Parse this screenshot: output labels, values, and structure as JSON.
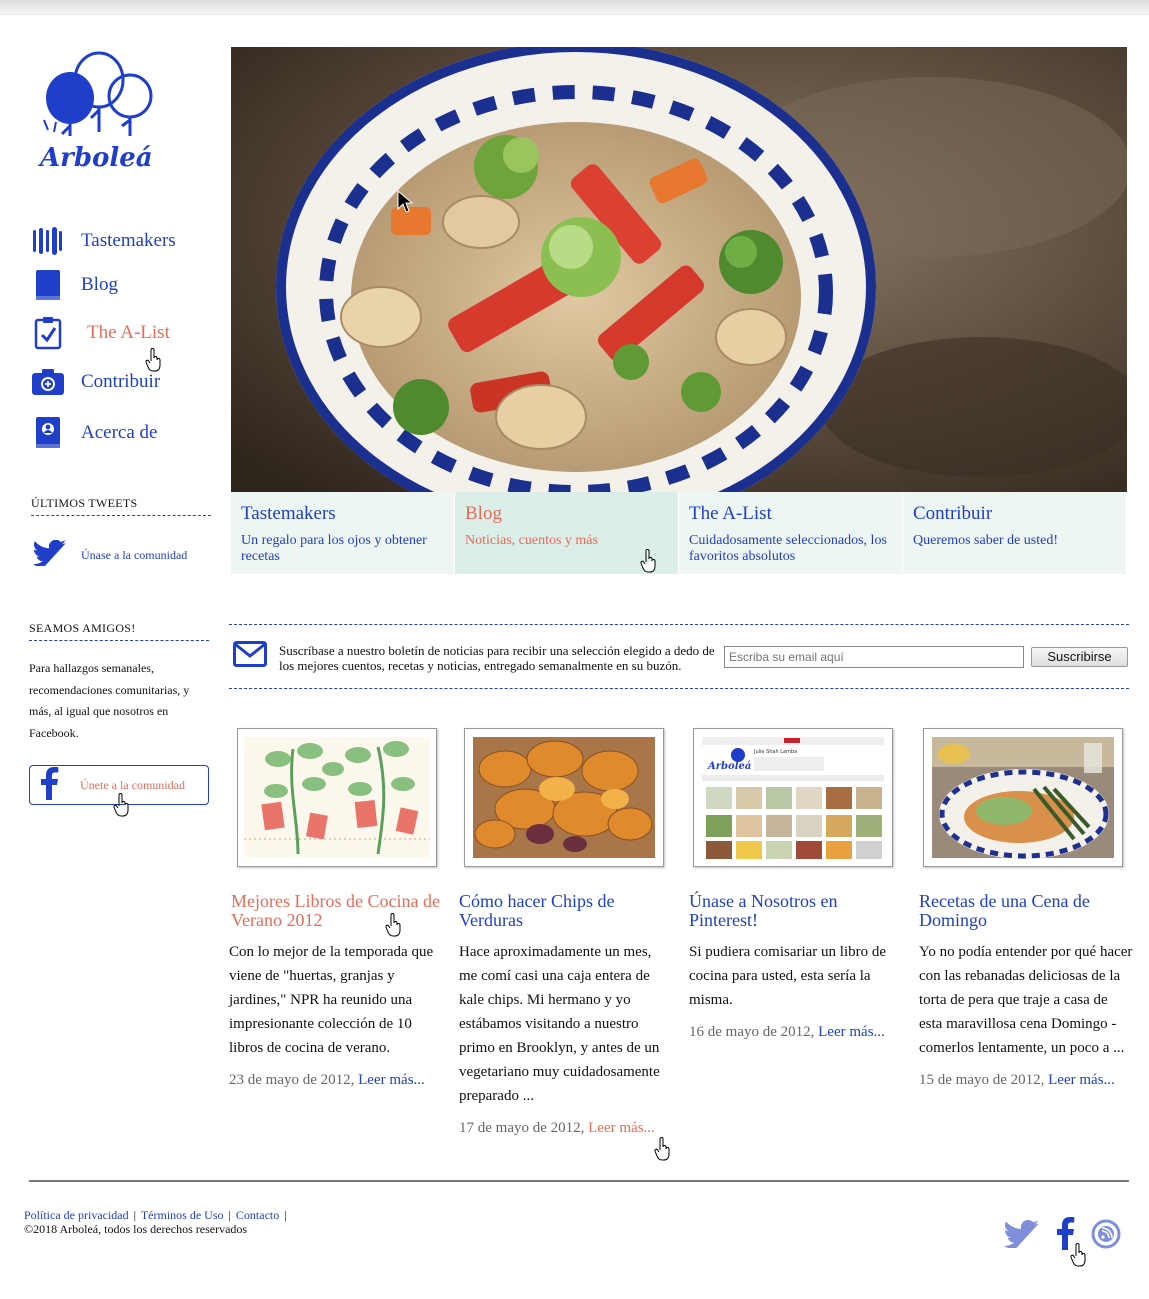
{
  "brand": {
    "name": "Arboleá"
  },
  "colors": {
    "primary": "#1f3ec9",
    "accent": "#e66c5a",
    "tab_bg": "#eef6f3"
  },
  "sidebar": {
    "nav": [
      {
        "label": "Tastemakers",
        "icon": "utensils-icon"
      },
      {
        "label": "Blog",
        "icon": "book-icon"
      },
      {
        "label": "The A-List",
        "icon": "clipboard-check-icon",
        "active": true
      },
      {
        "label": "Contribuir",
        "icon": "camera-icon"
      },
      {
        "label": "Acerca de",
        "icon": "profile-book-icon"
      }
    ],
    "tweets_heading": "ÚLTIMOS TWEETS",
    "tweets_link": "Únase a la comunidad",
    "friends_heading": "SEAMOS AMIGOS!",
    "friends_text": "Para hallazgos semanales, recomendaciones comunitarias, y más, al igual que nosotros en Facebook.",
    "fb_button": "Únete a la comunidad"
  },
  "tabs": [
    {
      "title": "Tastemakers",
      "subtitle": "Un regalo para los ojos y obtener recetas"
    },
    {
      "title": "Blog",
      "subtitle": "Noticias, cuentos y más",
      "active": true
    },
    {
      "title": "The A-List",
      "subtitle": "Cuidadosamente seleccionados, los favoritos absolutos"
    },
    {
      "title": "Contribuir",
      "subtitle": "Queremos saber de usted!"
    }
  ],
  "newsletter": {
    "text": "Suscríbase a nuestro boletín de noticias para recibir una selección elegido a dedo de los mejores cuentos, recetas y noticias, entregado semanalmente en su buzón.",
    "placeholder": "Escriba su email aquí",
    "button": "Suscribirse"
  },
  "posts": [
    {
      "title": "Mejores Libros de Cocina de Verano 2012",
      "body": "Con lo mejor de la temporada que viene de \"huertas, granjas y jardines,\" NPR ha reunido una impresionante colección de 10 libros de cocina de verano.",
      "date": "23 de mayo de 2012,",
      "more": "Leer más..."
    },
    {
      "title": "Cómo hacer Chips de Verduras",
      "body": "Hace aproximadamente un mes, me comí casi una caja entera de kale chips. Mi hermano y yo estábamos visitando a nuestro primo en Brooklyn, y antes de un vegetariano muy cuidadosamente preparado ...",
      "date": "17 de mayo de 2012,",
      "more": "Leer más..."
    },
    {
      "title": "Únase a Nosotros en Pinterest!",
      "body": "Si pudiera comisariar un libro de cocina para usted, esta sería la misma.",
      "date": "16 de mayo de 2012,",
      "more": "Leer más..."
    },
    {
      "title": "Recetas de una Cena de Domingo",
      "body": "Yo no podía entender por qué hacer con las rebanadas deliciosas de la torta de pera que traje a casa de esta maravillosa cena Domingo - comerlos lentamente, un poco a ...",
      "date": "15 de mayo de 2012,",
      "more": "Leer más..."
    }
  ],
  "pinterest_thumb": {
    "name": "Julie Shah Lamba",
    "brand": "Arboleá"
  },
  "footer": {
    "links": [
      "Política de privacidad",
      "Términos de Uso",
      "Contacto"
    ],
    "copyright": "©2018 Arboleá, todos los derechos reservados"
  }
}
